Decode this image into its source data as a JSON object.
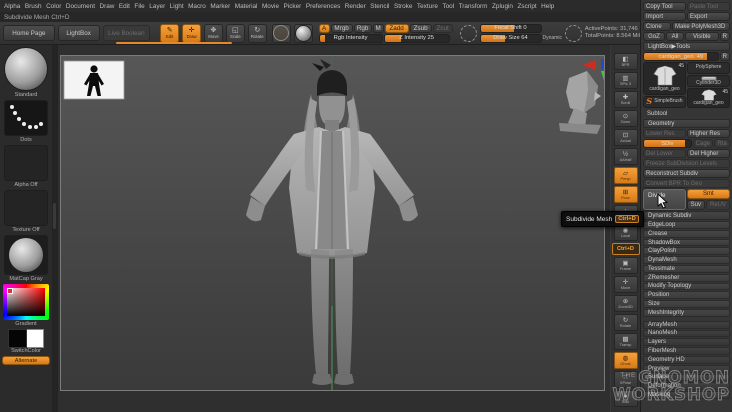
{
  "menubar": {
    "items": [
      "Alpha",
      "Brush",
      "Color",
      "Document",
      "Draw",
      "Edit",
      "File",
      "Layer",
      "Light",
      "Macro",
      "Marker",
      "Material",
      "Movie",
      "Picker",
      "Preferences",
      "Render",
      "Stencil",
      "Stroke",
      "Texture",
      "Tool",
      "Transform",
      "Zplugin",
      "Zscript",
      "Help"
    ]
  },
  "status_bar": {
    "text": "Subdivide Mesh Ctrl+D"
  },
  "toolbar": {
    "home_page": "Home Page",
    "lightbox": "LightBox",
    "live_boolean": "Live Boolean",
    "edit": "Edit",
    "draw": "Draw",
    "move": "Move",
    "scale": "Scale",
    "rotate": "Rotate",
    "a": "A",
    "mrgb": "Mrgb",
    "rgb": "Rgb",
    "m": "M",
    "zadd": "Zadd",
    "zsub": "Zsub",
    "zcut": "Zcut",
    "rgb_intensity": "Rgb Intensity",
    "z_intensity": "Z Intensity 25",
    "focal_shift": "Focal Shift 0",
    "draw_size": "Draw Size 64",
    "dynamic": "Dynamic",
    "active_points": "ActivePoints: 31,746",
    "total_points": "TotalPoints: 8.564 Mil"
  },
  "icons": {
    "edit": "✎",
    "draw": "✛",
    "move": "✥",
    "scale": "◱",
    "rotate": "↻"
  },
  "left_palette": {
    "standard": "Standard",
    "dots": "Dots",
    "alpha": "Alpha Off",
    "texture": "Texture Off",
    "matcap": "MatCap Gray",
    "gradient": "Gradient",
    "switch_color": "SwitchColor",
    "alternate": "Alternate"
  },
  "right_shelf": {
    "items": [
      {
        "label": "BPR",
        "glyph": "◧"
      },
      {
        "label": "SPix 3",
        "glyph": "▥"
      },
      {
        "label": "Scroll",
        "glyph": "✚"
      },
      {
        "label": "Zoom",
        "glyph": "⊙"
      },
      {
        "label": "Actual",
        "glyph": "⊡"
      },
      {
        "label": "AAHalf",
        "glyph": "½"
      },
      {
        "label": "Persp",
        "glyph": "▱"
      },
      {
        "label": "Floor",
        "glyph": "⊞"
      },
      {
        "label": "L.Sym",
        "glyph": "∴"
      },
      {
        "label": "Local",
        "glyph": "◉"
      },
      {
        "label": "Frame",
        "glyph": "▣"
      },
      {
        "label": "Move",
        "glyph": "✛"
      },
      {
        "label": "Zoom3D",
        "glyph": "⊕"
      },
      {
        "label": "Rotate",
        "glyph": "↻"
      },
      {
        "label": "Transp",
        "glyph": "▩"
      },
      {
        "label": "Ghost",
        "glyph": "◍"
      },
      {
        "label": "XPose",
        "glyph": "∷"
      },
      {
        "label": "Solo",
        "glyph": "●"
      }
    ]
  },
  "keypress_badge": "Ctrl+D",
  "tooltip": {
    "text": "Subdivide Mesh",
    "shortcut": "Ctrl+D"
  },
  "right_panel": {
    "copy_tool": "Copy Tool",
    "paste_tool": "Paste Tool",
    "import": "Import",
    "export": "Export",
    "clone": "Clone",
    "make_polymesh3d": "Make PolyMesh3D",
    "goz": "GoZ",
    "all": "All",
    "visible": "Visible",
    "r": "R",
    "lightbox_tools": "LightBox▶Tools",
    "active_tool_slider": "cardigan_geo. 49",
    "slider_r": "R",
    "thumbnails": {
      "active": {
        "label": "cardigan_geo",
        "badge": "45"
      },
      "polysphere": "PolySphere",
      "cylinder3d": "Cylinder3D",
      "simplebrush": "SimpleBrush",
      "recent": {
        "label": "cardigan_geo",
        "badge": "45"
      }
    },
    "subtool": "Subtool",
    "geometry": "Geometry",
    "lower_res": "Lower Res",
    "higher_res": "Higher Res",
    "sdiv": "SDiv",
    "cage": "Cage",
    "rta": "Rta",
    "del_lower": "Del Lower",
    "del_higher": "Del Higher",
    "freeze": "Freeze SubDivision Levels",
    "reconstruct": "Reconstruct Subdiv",
    "convert_bpr": "Convert BPR To Geo",
    "divide": "Divide",
    "smt": "Smt",
    "suv": "Suv",
    "reuv": "ReUV",
    "dynamic_subdiv": "Dynamic Subdiv",
    "sections": [
      "EdgeLoop",
      "Crease",
      "ShadowBox",
      "ClayPolish",
      "DynaMesh",
      "Tessimate",
      "ZRemesher",
      "Modify Topology",
      "Position",
      "Size",
      "MeshIntegrity"
    ],
    "sections_lower": [
      "ArrayMesh",
      "NanoMesh",
      "Layers",
      "FiberMesh",
      "Geometry HD",
      "Preview",
      "Surface",
      "Deformation",
      "Masking"
    ]
  },
  "watermark": {
    "the": "THE",
    "line1": "GNOMON",
    "line2": "WORKSHOP"
  },
  "colors": {
    "accent_orange": "#e8862a",
    "canvas_top": "#575757",
    "canvas_bottom": "#3a3a3a",
    "matcap_gray": "#a0a0a0"
  }
}
